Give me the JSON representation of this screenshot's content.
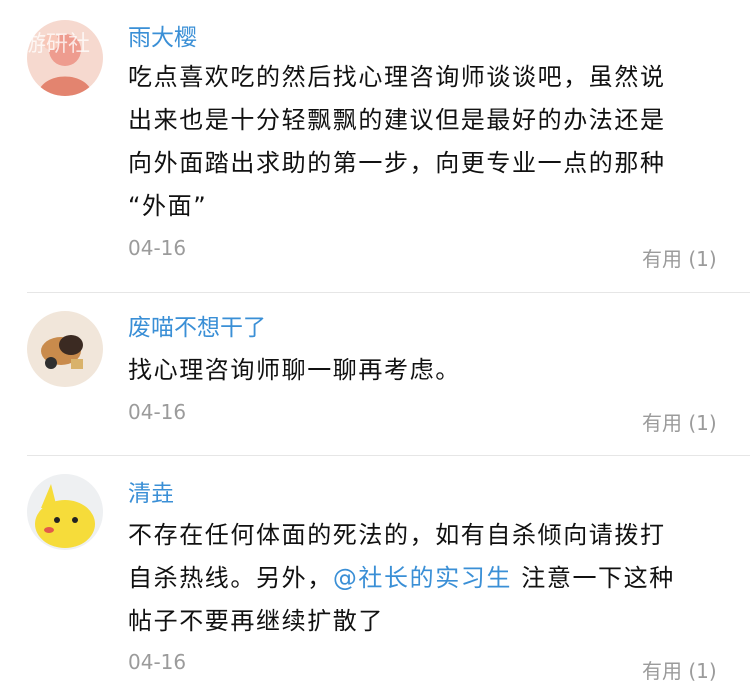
{
  "watermark": "游研社",
  "comments": [
    {
      "author": "雨大樱",
      "lines": [
        "吃点喜欢吃的然后找心理咨询师谈谈吧，虽然说",
        "出来也是十分轻飘飘的建议但是最好的办法还是",
        "向外面踏出求助的第一步，向更专业一点的那种",
        "“外面”"
      ],
      "date": "04-16",
      "useful": "有用 (1)"
    },
    {
      "author": "废喵不想干了",
      "lines": [
        "找心理咨询师聊一聊再考虑。"
      ],
      "date": "04-16",
      "useful": "有用 (1)"
    },
    {
      "author": "清垚",
      "lines": [
        "不存在任何体面的死法的，如有自杀倾向请拨打",
        "自杀热线。另外，"
      ],
      "mention": "@社长的实习生",
      "line2_tail": " 注意一下这种",
      "line3": "帖子不要再继续扩散了",
      "date": "04-16",
      "useful": "有用 (1)"
    }
  ],
  "colors": {
    "link": "#3a8fd6",
    "meta": "#9b9b9b",
    "divider": "#e6e6e6"
  }
}
